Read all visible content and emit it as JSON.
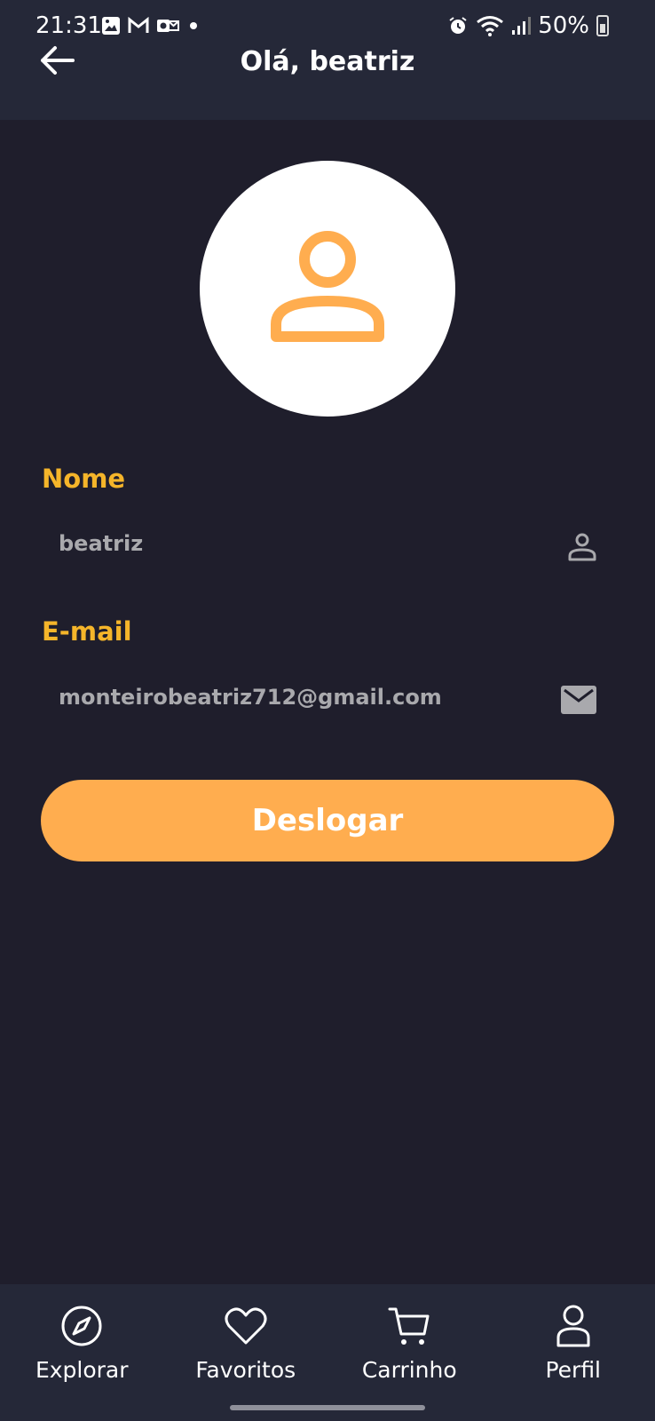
{
  "status_bar": {
    "time": "21:31",
    "battery": "50%",
    "icons": [
      "image-icon",
      "gmail-icon",
      "outlook-icon",
      "dot-icon",
      "alarm-icon",
      "wifi-icon",
      "signal-icon",
      "battery-icon"
    ]
  },
  "header": {
    "title": "Olá, beatriz",
    "back_icon": "arrow-left-icon"
  },
  "profile": {
    "avatar_icon": "user-icon",
    "name_label": "Nome",
    "name_value": "beatriz",
    "email_label": "E-mail",
    "email_value": "monteirobeatriz712@gmail.com",
    "logout_label": "Deslogar"
  },
  "bottom_nav": {
    "items": [
      {
        "label": "Explorar",
        "icon": "compass-icon"
      },
      {
        "label": "Favoritos",
        "icon": "heart-icon"
      },
      {
        "label": "Carrinho",
        "icon": "cart-icon"
      },
      {
        "label": "Perfil",
        "icon": "user-icon"
      }
    ]
  },
  "colors": {
    "background": "#1f1e2c",
    "bar": "#252838",
    "accent": "#ffad4f",
    "label": "#f5b52a",
    "muted_text": "#a9a9ad"
  }
}
